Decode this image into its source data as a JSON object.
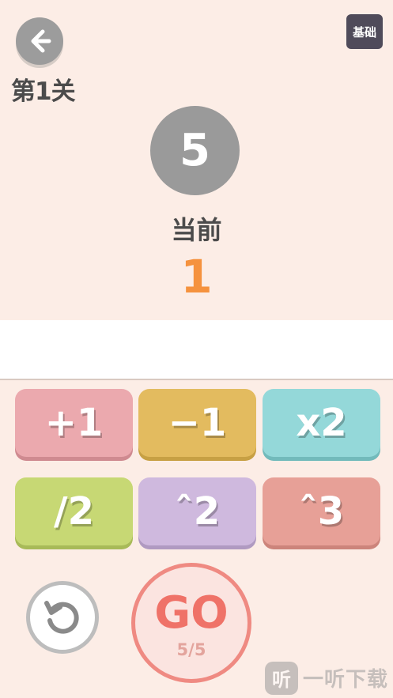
{
  "header": {
    "level_label": "第1关",
    "mode_button_label": "基础"
  },
  "target": {
    "value": "5"
  },
  "current": {
    "label": "当前",
    "value": "1"
  },
  "display": {
    "expression": ""
  },
  "operations": [
    {
      "label": "+1",
      "color": "#eba9ae"
    },
    {
      "label": "−1",
      "color": "#e3bb5f"
    },
    {
      "label": "x2",
      "color": "#94d8d9"
    },
    {
      "label": "/2",
      "color": "#c7d874"
    },
    {
      "label": "ˆ2",
      "color": "#cfb9de"
    },
    {
      "label": "ˆ3",
      "color": "#e7a097"
    }
  ],
  "controls": {
    "reset_icon": "reset-icon",
    "go_label": "GO",
    "go_count": "5/5"
  },
  "watermark": {
    "logo_char": "听",
    "text": "一听下载"
  }
}
